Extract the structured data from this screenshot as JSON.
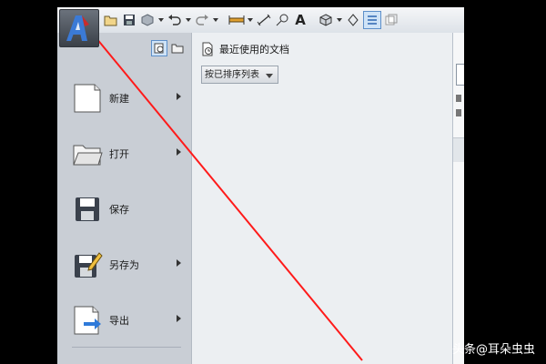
{
  "left_menu": {
    "items": [
      {
        "label": "新建",
        "icon": "new-document-icon"
      },
      {
        "label": "打开",
        "icon": "open-folder-icon"
      },
      {
        "label": "保存",
        "icon": "save-icon"
      },
      {
        "label": "另存为",
        "icon": "save-as-icon"
      },
      {
        "label": "导出",
        "icon": "export-icon"
      }
    ]
  },
  "recent": {
    "title": "最近使用的文档",
    "sort_value": "按已排序列表"
  },
  "toolbar": {
    "text_tool": "A"
  },
  "watermark": "头条@耳朵虫虫",
  "colors": {
    "annotation": "#ff1a1a",
    "accent": "#3b7ad6"
  }
}
